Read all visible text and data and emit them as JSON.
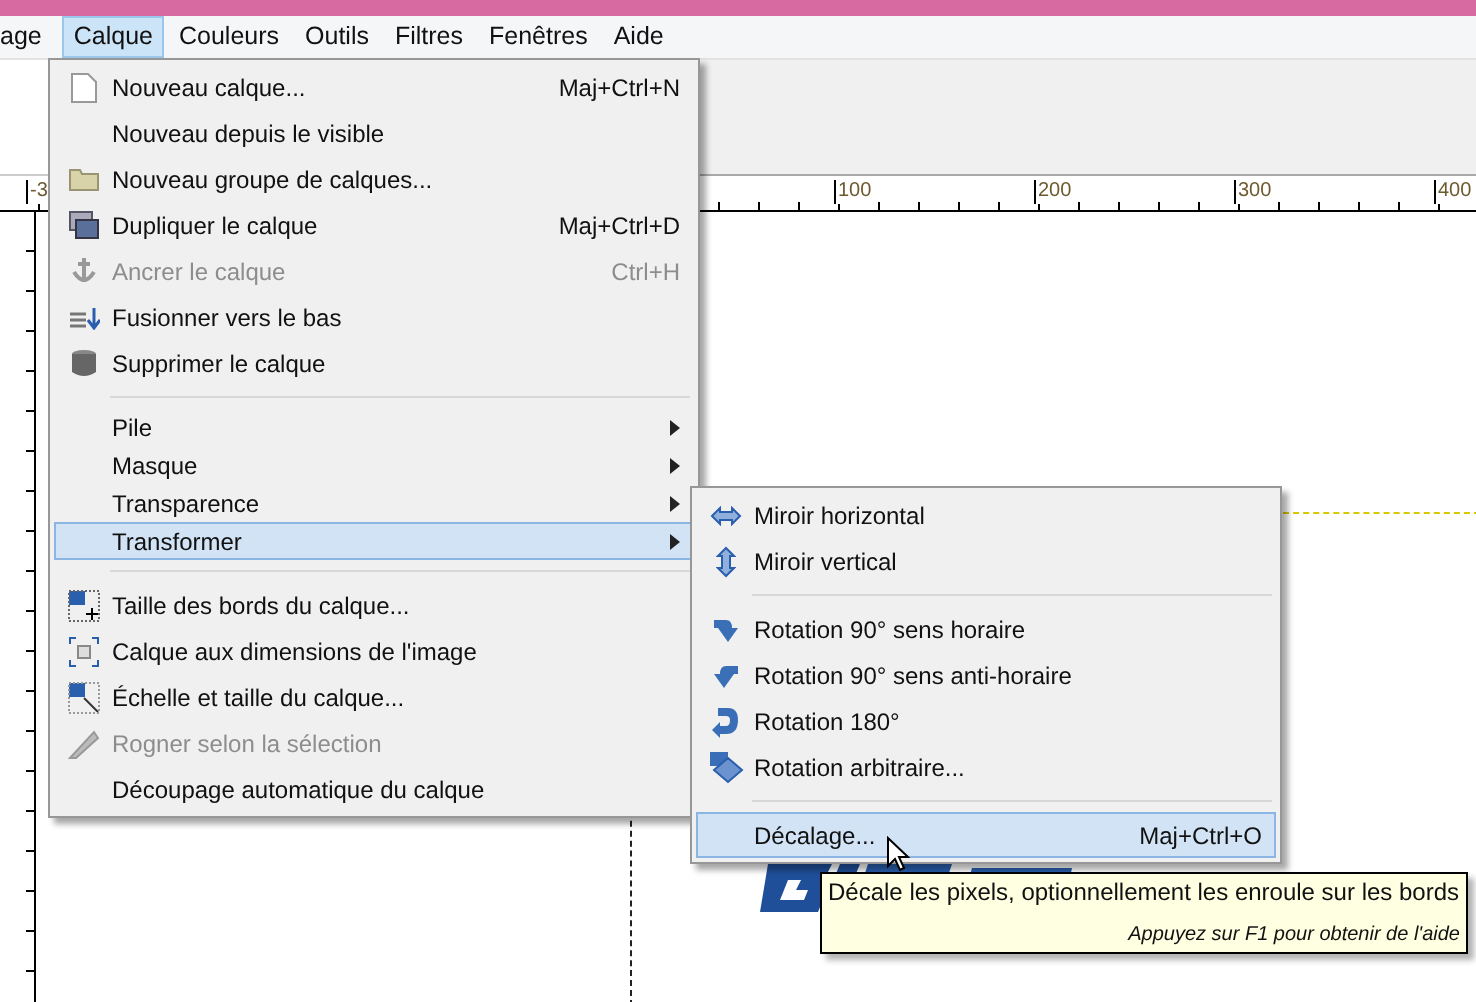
{
  "menubar": [
    {
      "label": "age",
      "selected": false
    },
    {
      "label": "Calque",
      "selected": true
    },
    {
      "label": "Couleurs",
      "selected": false
    },
    {
      "label": "Outils",
      "selected": false
    },
    {
      "label": "Filtres",
      "selected": false
    },
    {
      "label": "Fenêtres",
      "selected": false
    },
    {
      "label": "Aide",
      "selected": false
    }
  ],
  "ruler": {
    "labels": [
      "-3",
      "100",
      "200",
      "300",
      "400"
    ]
  },
  "layer_menu": [
    {
      "kind": "item",
      "label": "Nouveau calque...",
      "shortcut": "Maj+Ctrl+N",
      "disabled": false,
      "submenu": false,
      "selected": false
    },
    {
      "kind": "item",
      "label": "Nouveau depuis le visible",
      "disabled": false,
      "submenu": false,
      "selected": false
    },
    {
      "kind": "item",
      "label": "Nouveau groupe de calques...",
      "disabled": false,
      "submenu": false,
      "selected": false
    },
    {
      "kind": "item",
      "label": "Dupliquer le calque",
      "shortcut": "Maj+Ctrl+D",
      "disabled": false,
      "submenu": false,
      "selected": false
    },
    {
      "kind": "item",
      "label": "Ancrer le calque",
      "shortcut": "Ctrl+H",
      "disabled": true,
      "submenu": false,
      "selected": false
    },
    {
      "kind": "item",
      "label": "Fusionner vers le bas",
      "disabled": false,
      "submenu": false,
      "selected": false
    },
    {
      "kind": "item",
      "label": "Supprimer le calque",
      "disabled": false,
      "submenu": false,
      "selected": false
    },
    {
      "kind": "separator"
    },
    {
      "kind": "item",
      "label": "Pile",
      "disabled": false,
      "submenu": true,
      "selected": false
    },
    {
      "kind": "item",
      "label": "Masque",
      "disabled": false,
      "submenu": true,
      "selected": false
    },
    {
      "kind": "item",
      "label": "Transparence",
      "disabled": false,
      "submenu": true,
      "selected": false
    },
    {
      "kind": "item",
      "label": "Transformer",
      "disabled": false,
      "submenu": true,
      "selected": true
    },
    {
      "kind": "separator"
    },
    {
      "kind": "item",
      "label": "Taille des bords du calque...",
      "disabled": false,
      "submenu": false,
      "selected": false
    },
    {
      "kind": "item",
      "label": "Calque aux dimensions de l'image",
      "disabled": false,
      "submenu": false,
      "selected": false
    },
    {
      "kind": "item",
      "label": "Échelle et taille du calque...",
      "disabled": false,
      "submenu": false,
      "selected": false
    },
    {
      "kind": "item",
      "label": "Rogner selon la sélection",
      "disabled": true,
      "submenu": false,
      "selected": false
    },
    {
      "kind": "item",
      "label": "Découpage automatique du calque",
      "disabled": false,
      "submenu": false,
      "selected": false
    }
  ],
  "transform_menu": [
    {
      "kind": "item",
      "label": "Miroir horizontal",
      "selected": false
    },
    {
      "kind": "item",
      "label": "Miroir vertical",
      "selected": false
    },
    {
      "kind": "separator"
    },
    {
      "kind": "item",
      "label": "Rotation 90° sens horaire",
      "selected": false
    },
    {
      "kind": "item",
      "label": "Rotation 90° sens anti-horaire",
      "selected": false
    },
    {
      "kind": "item",
      "label": "Rotation 180°",
      "selected": false
    },
    {
      "kind": "item",
      "label": "Rotation arbitraire...",
      "selected": false
    },
    {
      "kind": "separator"
    },
    {
      "kind": "item",
      "label": "Décalage...",
      "shortcut": "Maj+Ctrl+O",
      "selected": true
    }
  ],
  "tooltip": {
    "text": "Décale les pixels, optionnellement les enroule sur les bords",
    "hint": "Appuyez sur F1 pour obtenir de l'aide"
  }
}
